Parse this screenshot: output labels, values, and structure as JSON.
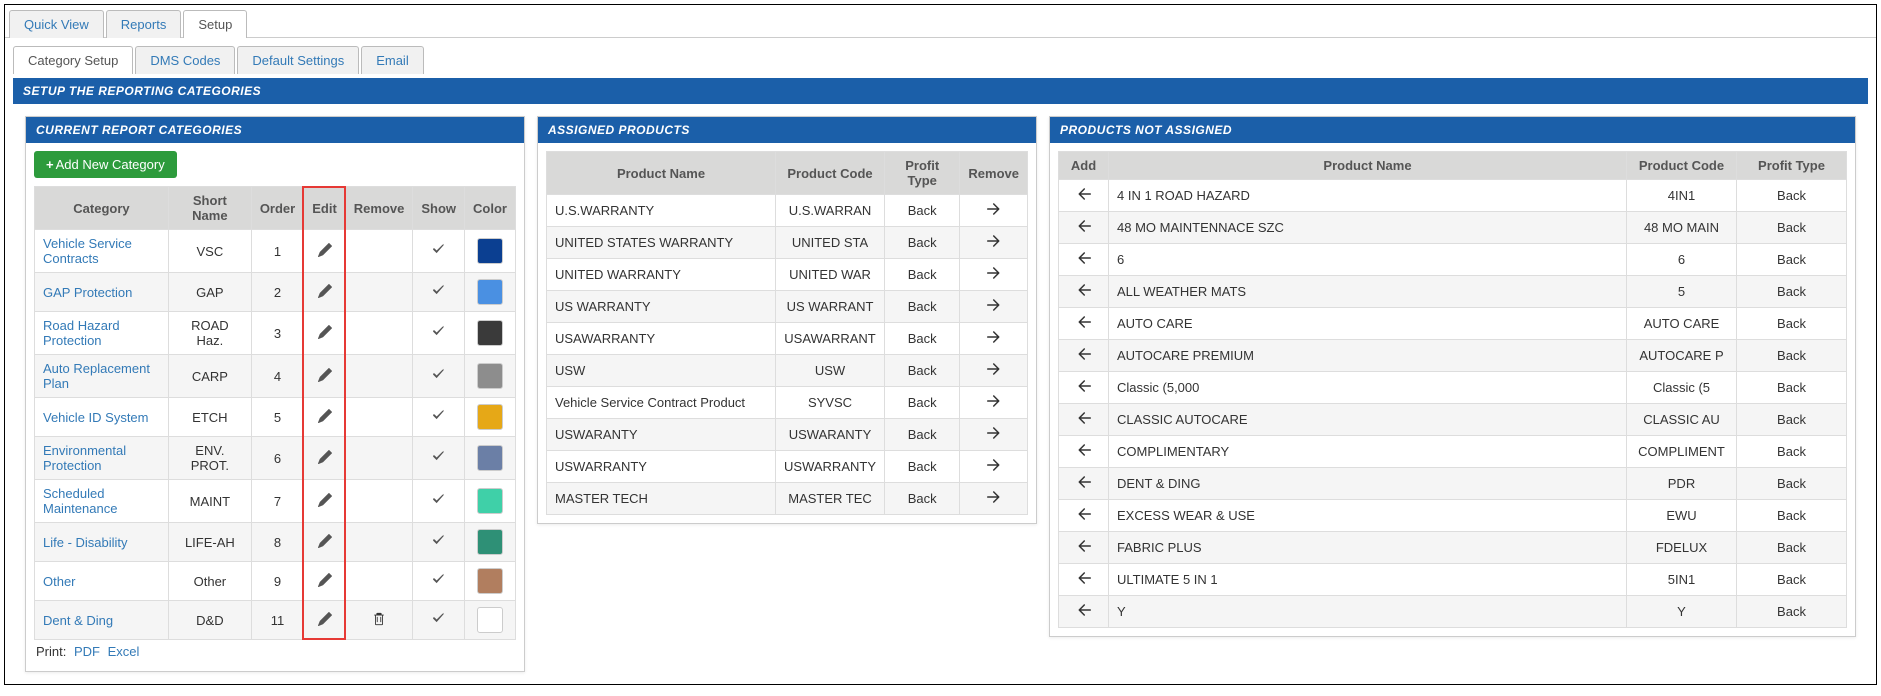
{
  "top_tabs": {
    "items": [
      {
        "label": "Quick View",
        "active": false
      },
      {
        "label": "Reports",
        "active": false
      },
      {
        "label": "Setup",
        "active": true
      }
    ]
  },
  "sub_tabs": {
    "items": [
      {
        "label": "Category Setup",
        "active": true
      },
      {
        "label": "DMS Codes",
        "active": false
      },
      {
        "label": "Default Settings",
        "active": false
      },
      {
        "label": "Email",
        "active": false
      }
    ]
  },
  "main_panel_title": "SETUP THE REPORTING CATEGORIES",
  "categories_panel": {
    "title": "CURRENT REPORT CATEGORIES",
    "add_btn": "Add New Category",
    "headers": {
      "category": "Category",
      "short": "Short Name",
      "order": "Order",
      "edit": "Edit",
      "remove": "Remove",
      "show": "Show",
      "color": "Color"
    },
    "rows": [
      {
        "name": "Vehicle Service Contracts",
        "short": "VSC",
        "order": "1",
        "show": true,
        "removable": false,
        "color": "#0b3f91"
      },
      {
        "name": "GAP Protection",
        "short": "GAP",
        "order": "2",
        "show": true,
        "removable": false,
        "color": "#4a90e2"
      },
      {
        "name": "Road Hazard Protection",
        "short": "ROAD Haz.",
        "order": "3",
        "show": true,
        "removable": false,
        "color": "#3a3a3a"
      },
      {
        "name": "Auto Replacement Plan",
        "short": "CARP",
        "order": "4",
        "show": true,
        "removable": false,
        "color": "#8d8d8d"
      },
      {
        "name": "Vehicle ID System",
        "short": "ETCH",
        "order": "5",
        "show": true,
        "removable": false,
        "color": "#e6a817"
      },
      {
        "name": "Environmental Protection",
        "short": "ENV. PROT.",
        "order": "6",
        "show": true,
        "removable": false,
        "color": "#6b7fa6"
      },
      {
        "name": "Scheduled Maintenance",
        "short": "MAINT",
        "order": "7",
        "show": true,
        "removable": false,
        "color": "#3fd0a8"
      },
      {
        "name": "Life - Disability",
        "short": "LIFE-AH",
        "order": "8",
        "show": true,
        "removable": false,
        "color": "#2e9076"
      },
      {
        "name": "Other",
        "short": "Other",
        "order": "9",
        "show": true,
        "removable": false,
        "color": "#b17e5f"
      },
      {
        "name": "Dent & Ding",
        "short": "D&D",
        "order": "11",
        "show": true,
        "removable": true,
        "color": "#ffffff"
      }
    ],
    "print_label": "Print:",
    "print_pdf": "PDF",
    "print_excel": "Excel"
  },
  "assigned_panel": {
    "title": "ASSIGNED PRODUCTS",
    "headers": {
      "name": "Product Name",
      "code": "Product Code",
      "profit": "Profit Type",
      "remove": "Remove"
    },
    "rows": [
      {
        "name": "U.S.WARRANTY",
        "code": "U.S.WARRAN",
        "profit": "Back"
      },
      {
        "name": "UNITED STATES WARRANTY",
        "code": "UNITED STA",
        "profit": "Back"
      },
      {
        "name": "UNITED WARRANTY",
        "code": "UNITED WAR",
        "profit": "Back"
      },
      {
        "name": "US WARRANTY",
        "code": "US WARRANT",
        "profit": "Back"
      },
      {
        "name": "USAWARRANTY",
        "code": "USAWARRANT",
        "profit": "Back"
      },
      {
        "name": "USW",
        "code": "USW",
        "profit": "Back"
      },
      {
        "name": "Vehicle Service Contract Product",
        "code": "SYVSC",
        "profit": "Back"
      },
      {
        "name": "USWARANTY",
        "code": "USWARANTY",
        "profit": "Back"
      },
      {
        "name": "USWARRANTY",
        "code": "USWARRANTY",
        "profit": "Back"
      },
      {
        "name": "MASTER TECH",
        "code": "MASTER TEC",
        "profit": "Back"
      }
    ]
  },
  "unassigned_panel": {
    "title": "PRODUCTS NOT ASSIGNED",
    "headers": {
      "add": "Add",
      "name": "Product Name",
      "code": "Product Code",
      "profit": "Profit Type"
    },
    "rows": [
      {
        "name": "4 IN 1 ROAD HAZARD",
        "code": "4IN1",
        "profit": "Back"
      },
      {
        "name": "48 MO MAINTENNACE SZC",
        "code": "48 MO MAIN",
        "profit": "Back"
      },
      {
        "name": "6",
        "code": "6",
        "profit": "Back"
      },
      {
        "name": "ALL WEATHER MATS",
        "code": "5",
        "profit": "Back"
      },
      {
        "name": "AUTO CARE",
        "code": "AUTO CARE",
        "profit": "Back"
      },
      {
        "name": "AUTOCARE PREMIUM",
        "code": "AUTOCARE P",
        "profit": "Back"
      },
      {
        "name": "Classic (5,000",
        "code": "Classic (5",
        "profit": "Back"
      },
      {
        "name": "CLASSIC AUTOCARE",
        "code": "CLASSIC AU",
        "profit": "Back"
      },
      {
        "name": "COMPLIMENTARY",
        "code": "COMPLIMENT",
        "profit": "Back"
      },
      {
        "name": "DENT & DING",
        "code": "PDR",
        "profit": "Back"
      },
      {
        "name": "EXCESS WEAR & USE",
        "code": "EWU",
        "profit": "Back"
      },
      {
        "name": "FABRIC PLUS",
        "code": "FDELUX",
        "profit": "Back"
      },
      {
        "name": "ULTIMATE 5 IN 1",
        "code": "5IN1",
        "profit": "Back"
      },
      {
        "name": "Y",
        "code": "Y",
        "profit": "Back"
      }
    ]
  }
}
